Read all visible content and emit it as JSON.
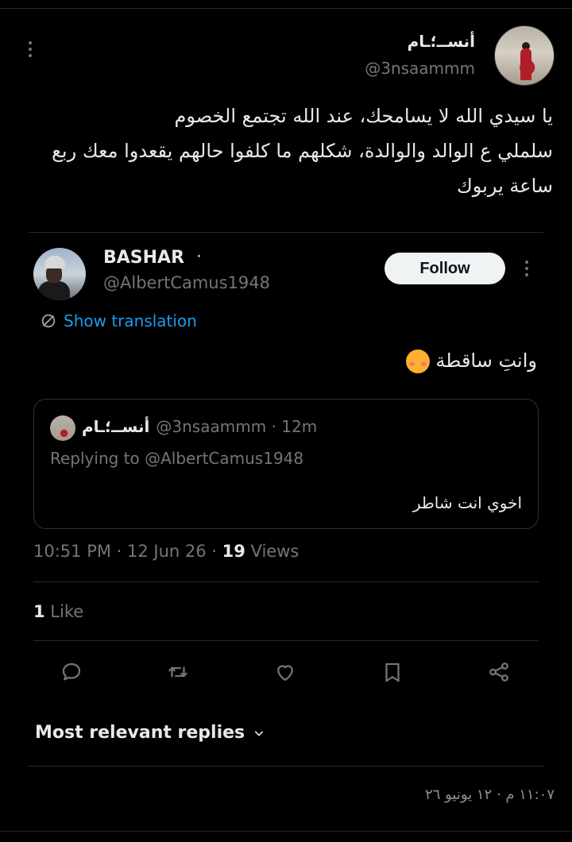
{
  "outer_tweet": {
    "author_name": "أنســ؛ـام",
    "handle": "@3nsaammm",
    "text_line1": "يا سيدي الله لا يسامحك، عند الله تجتمع الخصوم",
    "text_line2": "سلملي ع الوالد والوالدة، شكلهم ما كلفوا حالهم يقعدوا معك ربع",
    "text_line3": "ساعة يربوك"
  },
  "embedded_tweet": {
    "author_name": "BASHAR",
    "name_badge": "᛫",
    "handle": "@AlbertCamus1948",
    "follow_label": "Follow",
    "translate_label": "Show translation",
    "text": "وانتِ ساقطة",
    "quoted": {
      "author_name": "أنســ؛ـام",
      "handle_time": "@3nsaammm · 12m",
      "replying": "Replying to @AlbertCamus1948",
      "text": "اخوي انت شاطر"
    },
    "meta_prefix": "10:51 PM · 12 Jun 26 · ",
    "views_count": "19",
    "views_label": " Views",
    "likes_count": "1",
    "likes_label": " Like"
  },
  "actions": {
    "icons": [
      "reply-icon",
      "retweet-icon",
      "like-icon",
      "bookmark-icon",
      "share-icon"
    ]
  },
  "replies_sort_label": "Most relevant replies",
  "footer_timestamp": "١١:٠٧ م · ١٢ يونيو ٢٦",
  "colors": {
    "background": "#000000",
    "text": "#e7e9ea",
    "muted": "#71767b",
    "link": "#1d9bf0"
  }
}
